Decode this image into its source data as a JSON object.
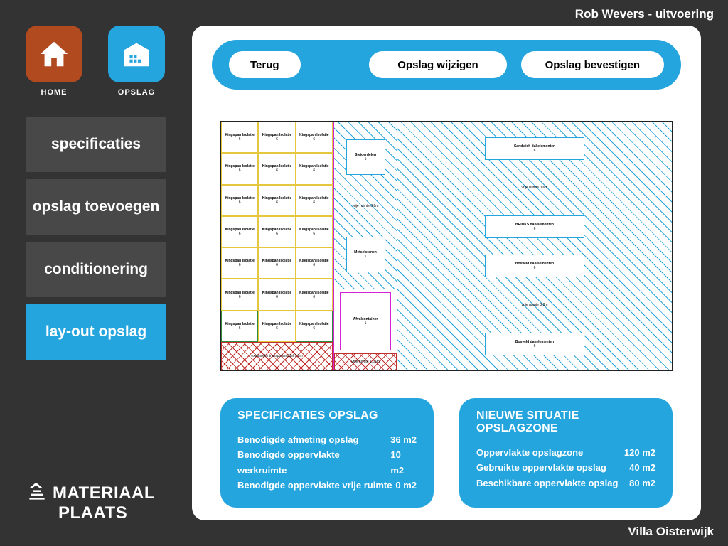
{
  "header": {
    "user": "Rob Wevers - uitvoering"
  },
  "footer": {
    "project": "Villa Oisterwijk"
  },
  "topIcons": {
    "home": {
      "label": "HOME"
    },
    "opslag": {
      "label": "OPSLAG"
    }
  },
  "sidebar": {
    "items": [
      {
        "label": "specificaties",
        "active": false
      },
      {
        "label": "opslag toevoegen",
        "active": false
      },
      {
        "label": "conditionering",
        "active": false
      },
      {
        "label": "lay-out opslag",
        "active": true
      }
    ]
  },
  "brand": {
    "line1": "MATERIAAL",
    "line2": "PLAATS"
  },
  "actions": {
    "back": "Terug",
    "modify": "Opslag wijzigen",
    "confirm": "Opslag bevestigen"
  },
  "diagram": {
    "gridCell": "Kingspan Isolatie",
    "transport": "extrinsieke transportmiddel 1,8m",
    "mid": {
      "top1": "Steigerdelen",
      "top1b": "1",
      "top2": "Metselstenen",
      "top2b": "1",
      "vrij": "vrije ruimte 0,8m",
      "apo": "Afvalcontainer",
      "apob": "1",
      "cross": "vrije ruimte 1,65m"
    },
    "right": {
      "b1": "Sandwich dakelementen",
      "b1b": "6",
      "l1": "vrije ruimte 0,6m",
      "b2": "BRINKS dakelementen",
      "b2b": "6",
      "b3": "Bosveld dakelementen",
      "b3b": "6",
      "l2": "vrije ruimte 3,8m",
      "b4": "Bosveld dakelementen",
      "b4b": "6"
    }
  },
  "cardSpec": {
    "title": "SPECIFICATIES OPSLAG",
    "rows": [
      {
        "label": "Benodigde afmeting opslag",
        "value": "36 m2"
      },
      {
        "label": "Benodigde oppervlakte werkruimte",
        "value": "10 m2"
      },
      {
        "label": "Benodigde oppervlakte vrije ruimte",
        "value": "0 m2"
      }
    ]
  },
  "cardZone": {
    "title": "NIEUWE SITUATIE OPSLAGZONE",
    "rows": [
      {
        "label": "Oppervlakte opslagzone",
        "value": "120 m2"
      },
      {
        "label": "Gebruikte oppervlakte opslag",
        "value": "40 m2"
      },
      {
        "label": "Beschikbare oppervlakte opslag",
        "value": "80 m2"
      }
    ]
  }
}
